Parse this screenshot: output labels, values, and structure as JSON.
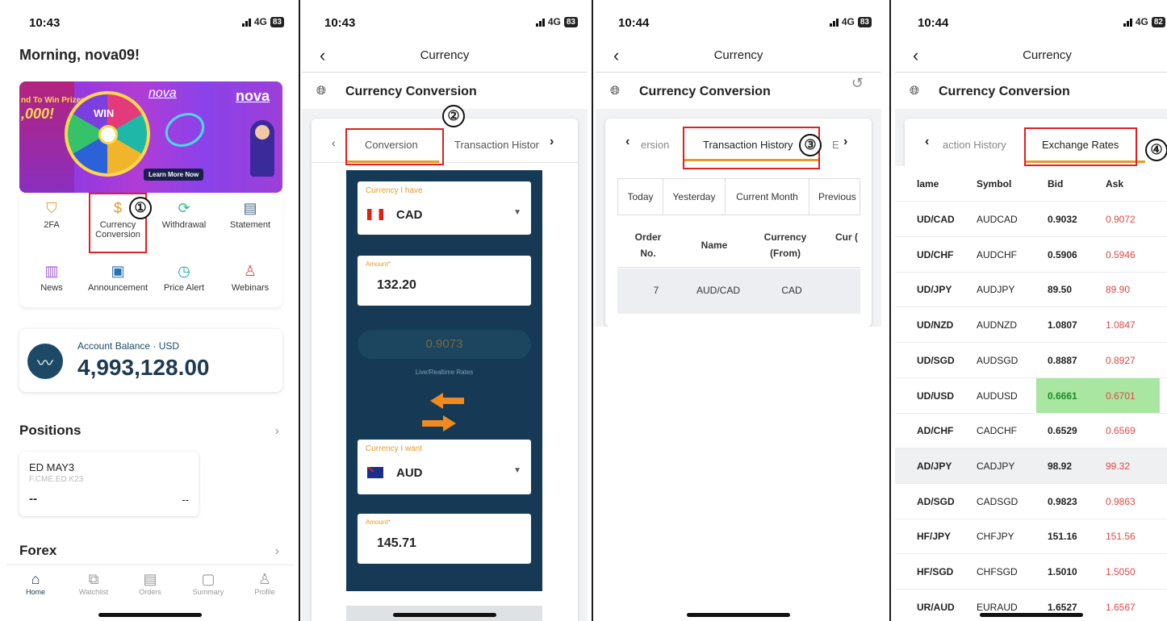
{
  "screens": [
    {
      "status": {
        "time": "10:43",
        "network": "4G",
        "battery": "83"
      },
      "greeting": "Morning, nova09!",
      "banner": {
        "promo_text": "nd To Win Prizes",
        "promo_amount": ",000!",
        "wheel_label": "WIN",
        "logo1": "nova",
        "logo2": "nova",
        "button": "Learn More Now"
      },
      "quick_actions": [
        {
          "label": "2FA",
          "icon": "shield-check-icon"
        },
        {
          "label": "Currency Conversion",
          "icon": "currency-exchange-icon"
        },
        {
          "label": "Withdrawal",
          "icon": "refresh-icon"
        },
        {
          "label": "Statement",
          "icon": "chart-document-icon"
        },
        {
          "label": "News",
          "icon": "book-icon"
        },
        {
          "label": "Announcement",
          "icon": "clipboard-icon"
        },
        {
          "label": "Price Alert",
          "icon": "alert-clock-icon"
        },
        {
          "label": "Webinars",
          "icon": "presenter-icon"
        }
      ],
      "balance": {
        "label": "Account Balance · USD",
        "amount": "4,993,128.00"
      },
      "positions": {
        "title": "Positions",
        "item": {
          "name": "ED MAY3",
          "code": "F.CME.ED.K23",
          "left": "--",
          "right": "--"
        }
      },
      "forex_title": "Forex",
      "tabs": [
        {
          "label": "Home",
          "icon": "home-icon"
        },
        {
          "label": "Watchlist",
          "icon": "chart-icon"
        },
        {
          "label": "Orders",
          "icon": "document-icon"
        },
        {
          "label": "Summary",
          "icon": "wallet-icon"
        },
        {
          "label": "Profile",
          "icon": "user-icon"
        }
      ],
      "marker": "①"
    },
    {
      "status": {
        "time": "10:43",
        "network": "4G",
        "battery": "83"
      },
      "nav_title": "Currency",
      "section_title": "Currency Conversion",
      "tabs": [
        "Conversion",
        "Transaction Histor"
      ],
      "have_label": "Currency I have",
      "have_currency": "CAD",
      "amount_label": "Amount*",
      "amount_from": "132.20",
      "rate": "0.9073",
      "rate_caption": "Live/Realtime Rates",
      "want_label": "Currency I want",
      "want_currency": "AUD",
      "amount_to": "145.71",
      "marker": "②"
    },
    {
      "status": {
        "time": "10:44",
        "network": "4G",
        "battery": "83"
      },
      "nav_title": "Currency",
      "section_title": "Currency Conversion",
      "tabs": [
        "ersion",
        "Transaction History",
        "E"
      ],
      "filters": [
        "Today",
        "Yesterday",
        "Current Month",
        "Previous"
      ],
      "columns": [
        "Order No.",
        "Name",
        "Currency (From)",
        "Cur ("
      ],
      "rows": [
        {
          "order": "7",
          "name": "AUD/CAD",
          "from": "CAD"
        }
      ],
      "marker": "③"
    },
    {
      "status": {
        "time": "10:44",
        "network": "4G",
        "battery": "82"
      },
      "nav_title": "Currency",
      "section_title": "Currency Conversion",
      "tabs": [
        "action History",
        "Exchange Rates"
      ],
      "columns": [
        "lame",
        "Symbol",
        "Bid",
        "Ask"
      ],
      "rows": [
        {
          "name": "UD/CAD",
          "symbol": "AUDCAD",
          "bid": "0.9032",
          "ask": "0.9072"
        },
        {
          "name": "UD/CHF",
          "symbol": "AUDCHF",
          "bid": "0.5906",
          "ask": "0.5946"
        },
        {
          "name": "UD/JPY",
          "symbol": "AUDJPY",
          "bid": "89.50",
          "ask": "89.90"
        },
        {
          "name": "UD/NZD",
          "symbol": "AUDNZD",
          "bid": "1.0807",
          "ask": "1.0847"
        },
        {
          "name": "UD/SGD",
          "symbol": "AUDSGD",
          "bid": "0.8887",
          "ask": "0.8927"
        },
        {
          "name": "UD/USD",
          "symbol": "AUDUSD",
          "bid": "0.6661",
          "ask": "0.6701"
        },
        {
          "name": "AD/CHF",
          "symbol": "CADCHF",
          "bid": "0.6529",
          "ask": "0.6569"
        },
        {
          "name": "AD/JPY",
          "symbol": "CADJPY",
          "bid": "98.92",
          "ask": "99.32"
        },
        {
          "name": "AD/SGD",
          "symbol": "CADSGD",
          "bid": "0.9823",
          "ask": "0.9863"
        },
        {
          "name": "HF/JPY",
          "symbol": "CHFJPY",
          "bid": "151.16",
          "ask": "151.56"
        },
        {
          "name": "HF/SGD",
          "symbol": "CHFSGD",
          "bid": "1.5010",
          "ask": "1.5050"
        },
        {
          "name": "UR/AUD",
          "symbol": "EURAUD",
          "bid": "1.6527",
          "ask": "1.6567"
        }
      ],
      "marker": "④"
    }
  ],
  "colors": {
    "highlight": "#e02020",
    "accent": "#e39b2c",
    "panel": "#163a55",
    "ask_red": "#e04848",
    "bid_green_bg": "#a8e6a1"
  }
}
